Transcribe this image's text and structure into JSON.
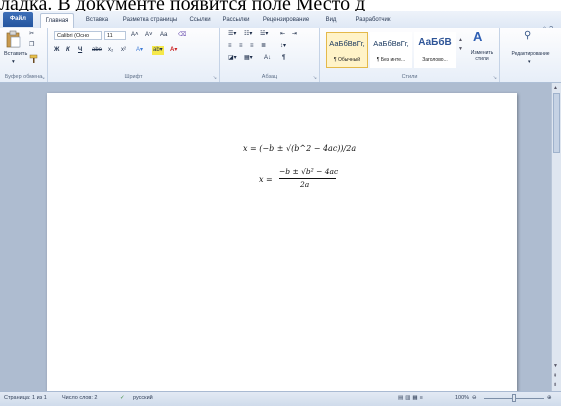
{
  "caption": "ладка. В документе появится поле Место д",
  "tabs": [
    "Файл",
    "Главная",
    "Вставка",
    "Разметка страницы",
    "Ссылки",
    "Рассылки",
    "Рецензирование",
    "Вид",
    "Разработчик"
  ],
  "clipboard": {
    "paste_label": "Вставить",
    "group_label": "Буфер обмена"
  },
  "font": {
    "family_value": "Calibri (Осно",
    "size_value": "11",
    "bold": "Ж",
    "italic": "К",
    "underline": "Ч",
    "strike": "abe",
    "sub": "x₂",
    "sup": "x²",
    "grow": "A˄",
    "shrink": "A˅",
    "case": "Aa",
    "group_label": "Шрифт"
  },
  "paragraph": {
    "pilcrow": "¶",
    "sort": "А↓",
    "group_label": "Абзац"
  },
  "styles": {
    "items": [
      {
        "sample": "АаБбВвГг,",
        "name": "¶ Обычный"
      },
      {
        "sample": "АаБбВвГг,",
        "name": "¶ Без инте..."
      },
      {
        "sample": "АаБбВ",
        "name": "Заголово..."
      }
    ],
    "change_label": "Изменить стили",
    "group_label": "Стили"
  },
  "editing": {
    "label": "Редактирование"
  },
  "document": {
    "formula_linear": "x = (−b ± √(b^2 − 4ac))/2a",
    "formula_lhs": "x =",
    "formula_numerator": "−b ± √b² − 4ac",
    "formula_denominator": "2a"
  },
  "status": {
    "page": "Страница: 1 из 1",
    "words": "Число слов: 2",
    "language": "русский",
    "zoom": "100%"
  },
  "colors": {
    "file_tab": "#2b5ba4",
    "ribbon": "#e7eef8",
    "workspace": "#aebcd0",
    "selected_style": "#fff3c8"
  }
}
